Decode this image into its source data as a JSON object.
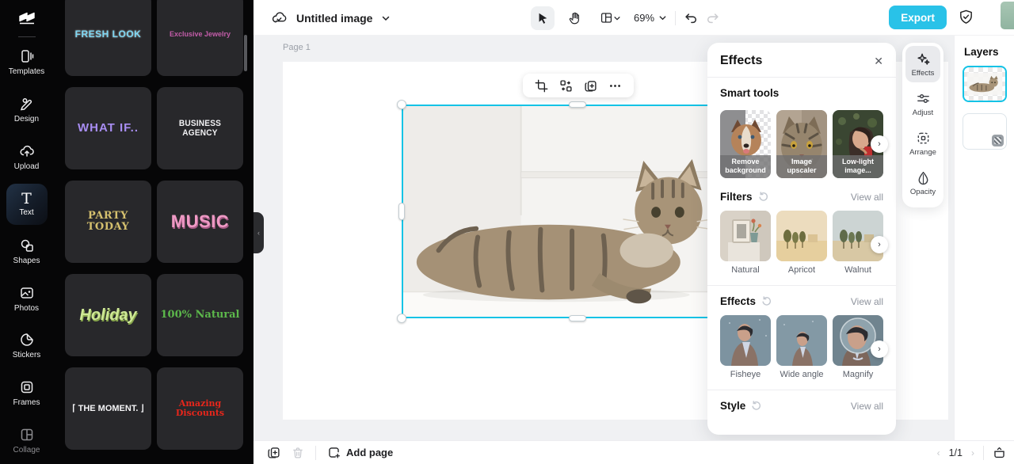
{
  "top_bar": {
    "project_title": "Untitled image",
    "zoom_level": "69%",
    "export_label": "Export"
  },
  "left_nav": {
    "items": [
      {
        "label": "Templates"
      },
      {
        "label": "Design"
      },
      {
        "label": "Upload"
      },
      {
        "label": "Text",
        "active": true
      },
      {
        "label": "Shapes"
      },
      {
        "label": "Photos"
      },
      {
        "label": "Stickers"
      },
      {
        "label": "Frames"
      },
      {
        "label": "Collage"
      }
    ]
  },
  "templates_panel": {
    "cards": [
      {
        "label": "FRESH LOOK",
        "color": "#7dd7f3"
      },
      {
        "label": "Exclusive Jewelry",
        "color": "#c25ca8"
      },
      {
        "label": "WHAT IF..",
        "color": "#a88df2"
      },
      {
        "label": "BUSINESS AGENCY",
        "color": "#f2f2f4"
      },
      {
        "label": "PARTY TODAY",
        "color": "#d5c06e"
      },
      {
        "label": "MUSIC",
        "color": "#ee9ac4"
      },
      {
        "label": "Holiday",
        "color": "#cfe996"
      },
      {
        "label": "100% Natural",
        "color": "#5cb84b"
      },
      {
        "label": "⌈ THE MOMENT. ⌋",
        "color": "#f4f4f6"
      },
      {
        "label": "Amazing Discounts",
        "color": "#e7261b"
      }
    ]
  },
  "canvas": {
    "page_label": "Page 1"
  },
  "effects_panel": {
    "title": "Effects",
    "smart_tools": {
      "title": "Smart tools",
      "items": [
        {
          "label": "Remove background",
          "highlighted": true
        },
        {
          "label": "Image upscaler"
        },
        {
          "label": "Low-light image..."
        }
      ]
    },
    "filters": {
      "title": "Filters",
      "view_all": "View all",
      "items": [
        {
          "label": "Natural"
        },
        {
          "label": "Apricot"
        },
        {
          "label": "Walnut"
        }
      ]
    },
    "effects": {
      "title": "Effects",
      "view_all": "View all",
      "items": [
        {
          "label": "Fisheye"
        },
        {
          "label": "Wide angle"
        },
        {
          "label": "Magnify"
        }
      ]
    },
    "style": {
      "title": "Style",
      "view_all": "View all"
    }
  },
  "right_rail": {
    "items": [
      {
        "label": "Effects",
        "active": true
      },
      {
        "label": "Adjust"
      },
      {
        "label": "Arrange"
      },
      {
        "label": "Opacity"
      }
    ]
  },
  "layers_panel": {
    "title": "Layers"
  },
  "bottom_bar": {
    "add_page_label": "Add page",
    "page_indicator": "1/1"
  },
  "colors": {
    "accent_cyan": "#29c2e8",
    "selection_cyan": "#14c3e6",
    "highlight_red": "#f4473c"
  }
}
